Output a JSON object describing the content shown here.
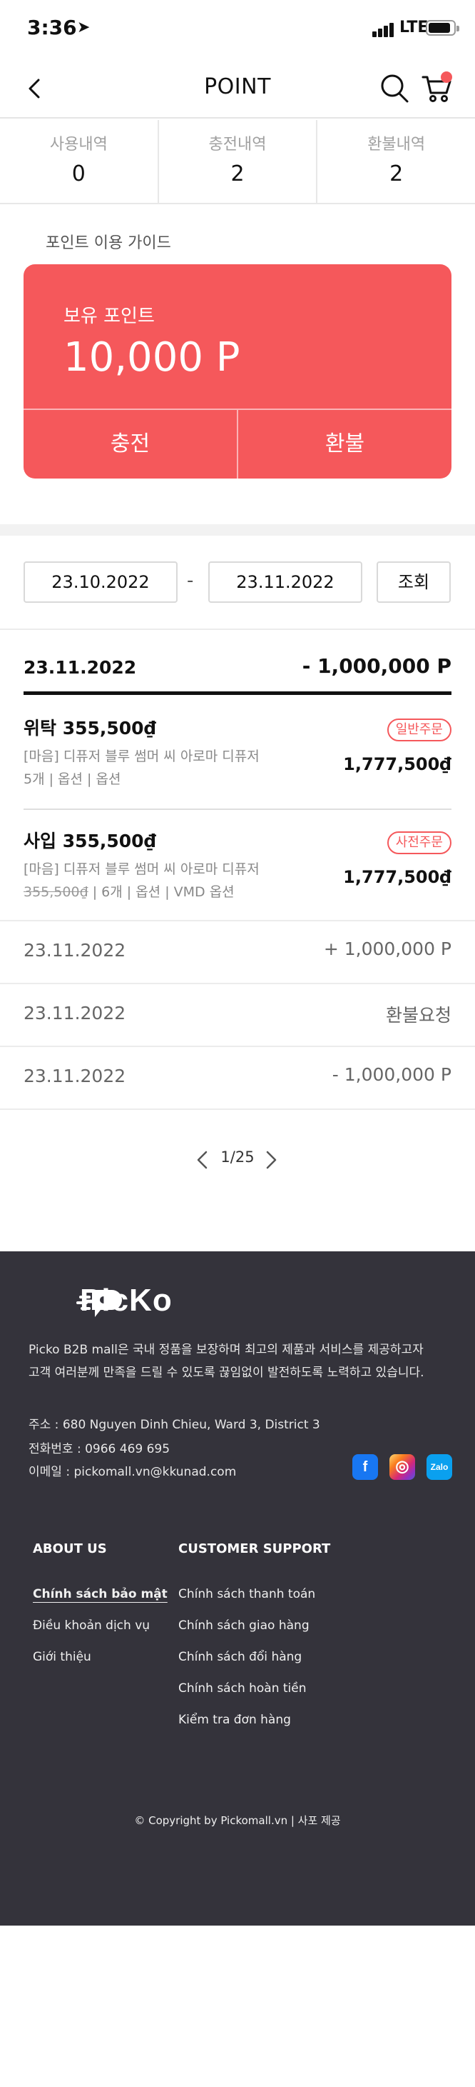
{
  "status_bar": {
    "time": "3:36",
    "network": "LTE"
  },
  "header": {
    "title": "POINT"
  },
  "stats": [
    {
      "label": "사용내역",
      "count": "0"
    },
    {
      "label": "충전내역",
      "count": "2"
    },
    {
      "label": "환불내역",
      "count": "2"
    }
  ],
  "guide_link": "포인트 이용 가이드",
  "points_card": {
    "label": "보유 포인트",
    "value": "10,000 P",
    "charge_label": "충전",
    "refund_label": "환불",
    "color": "#f5585b"
  },
  "filter": {
    "date_from": "23.10.2022",
    "separator": "-",
    "date_to": "23.11.2022",
    "search_label": "조회"
  },
  "history_group": {
    "date": "23.11.2022",
    "amount": "- 1,000,000 P",
    "items": [
      {
        "name": "위탁  355,500₫",
        "tag": "일반주문",
        "desc": "[마음] 디퓨저 블루 썸머 씨 아로마 디퓨저",
        "meta": "5개 | 옵션 | 옵션",
        "total": "1,777,500₫"
      },
      {
        "name": "사입  355,500₫",
        "tag": "사전주문",
        "desc": "[마음] 디퓨저 블루 썸머 씨 아로마 디퓨저",
        "meta_strike": "355,500₫",
        "meta": " | 6개 | 옵션 | VMD 옵션",
        "total": "1,777,500₫"
      }
    ]
  },
  "history_rows": [
    {
      "date": "23.11.2022",
      "value": "+ 1,000,000 P"
    },
    {
      "date": "23.11.2022",
      "value": "환불요청"
    },
    {
      "date": "23.11.2022",
      "value": "- 1,000,000 P"
    }
  ],
  "pagination": {
    "page": "1/25"
  },
  "footer": {
    "brand": "PicKo",
    "intro_line1": "Picko B2B mall은 국내 정품을 보장하며 최고의 제품과 서비스를 제공하고자",
    "intro_line2": "고객 여러분께 만족을 드릴 수 있도록 끊임없이 발전하도록 노력하고 있습니다.",
    "address": "주소 : 680 Nguyen Dinh Chieu, Ward 3, District 3",
    "phone": "전화번호 : 0966 469 695",
    "email": "이메일 : pickomall.vn@kkunad.com",
    "social": {
      "facebook": "f",
      "instagram": "◎",
      "zalo": "Zalo"
    },
    "about_title": "ABOUT US",
    "about_links": [
      "Chính sách bảo mật",
      "Điều khoản dịch vụ",
      "Giới thiệu"
    ],
    "support_title": "CUSTOMER SUPPORT",
    "support_links": [
      "Chính sách thanh toán",
      "Chính sách giao hàng",
      "Chính sách đổi hàng",
      "Chính sách hoàn tiền",
      "Kiểm tra đơn hàng"
    ],
    "copyright": "© Copyright by Pickomall.vn | 사포 제공"
  }
}
